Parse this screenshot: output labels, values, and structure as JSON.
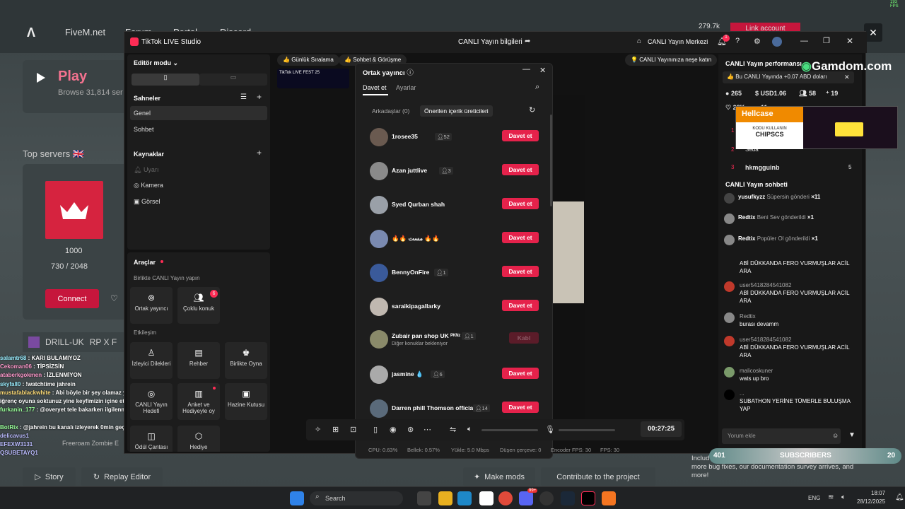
{
  "fivem": {
    "brand": "FiveM.net",
    "nav": [
      "Forum",
      "Portal",
      "Discord"
    ],
    "play": "Play",
    "browse": "Browse 31,814 ser",
    "top_servers": "Top servers",
    "server": {
      "points": "1000",
      "players": "730 / 2048",
      "connect": "Connect",
      "name": "DRILL-UK",
      "tag": "RP X F"
    },
    "votes": "279.7k",
    "link_account": "Link account",
    "story": "Story",
    "replay": "Replay Editor",
    "make_mods": "Make mods",
    "contribute": "Contribute to the project",
    "notice": "more bug fixes, our documentation survey arrives, and more!",
    "notice_prefix": "Includ",
    "freeroam": "Freeroam Zombie E"
  },
  "gta_chat": [
    {
      "n": "salamtr68",
      "m": "KARI BULAMIYOZ"
    },
    {
      "n": "Cekoman06",
      "m": "TİPSİZSİN"
    },
    {
      "n": "ataberkgokmen",
      "m": "İZLENMİYON"
    },
    {
      "n": "skyfall0",
      "m": "!watchtime jahrein"
    },
    {
      "n": "mustafablackwhite",
      "m": "Abi böyle bir şey olamaz ya şu"
    },
    {
      "n": "",
      "m": "iğrenç oyuna soktunuz yine keyfimizin içine ettiniz ya"
    },
    {
      "n": "furkanin_177",
      "m": "@overyet tele bakarken ilgilenmediki"
    },
    {
      "n": "BotRix",
      "m": "@jahrein bu kanalı izleyerek 0min geçirdi."
    },
    {
      "n": "delicavus1",
      "m": ""
    },
    {
      "n": "EFEXW3131",
      "m": ""
    },
    {
      "n": "QSUBETAYQ1",
      "m": ""
    }
  ],
  "tiktok": {
    "app": "TikTok LIVE Studio",
    "center": "CANLI Yayın bilgileri",
    "merkez": "CANLI Yayın Merkezi",
    "notif": "1",
    "editor": "Editör modu",
    "scenes": "Sahneler",
    "scene_items": [
      "Genel",
      "Sohbet"
    ],
    "sources": "Kaynaklar",
    "source_items": [
      "Uyarı",
      "Kamera",
      "Görsel"
    ],
    "tools": "Araçlar",
    "together": "Birlikte CANLI Yayın yapın",
    "co_host": "Ortak yayıncı",
    "multi_guest": "Çoklu konuk",
    "multi_badge": "6",
    "engage": "Etkileşim",
    "tools2": [
      "İzleyici Dilekleri",
      "Rehber",
      "Birlikte Oyna",
      "CANLI Yayın Hedefi",
      "Anket ve Hediyeyle oy",
      "Hazine Kutusu",
      "Ödül Çantası",
      "Hediye"
    ],
    "chip1": "Günlük Sıralama",
    "chip2": "Sohbet & Görüşme",
    "chip3": "CANLI Yayınınıza neşe katın",
    "livefest": "TikTok LIVE FEST 25",
    "modal": {
      "title": "Ortak yayıncı",
      "tab_invite": "Davet et",
      "tab_settings": "Ayarlar",
      "sub_friends": "Arkadaşlar (0)",
      "sub_suggested": "Önerilen içerik üreticileri",
      "rows": [
        {
          "name": "1rosee35",
          "count": "52",
          "btn": "Davet et",
          "sub": "",
          "c": "#6a5a50"
        },
        {
          "name": "Azan juttlive",
          "count": "3",
          "btn": "Davet et",
          "sub": "",
          "c": "#8a8a8a"
        },
        {
          "name": "Syed Qurban shah",
          "count": "",
          "btn": "Davet et",
          "sub": "",
          "c": "#9aa0a8"
        },
        {
          "name": "🔥🔥 مست 🔥🔥",
          "count": "",
          "btn": "Davet et",
          "sub": "",
          "c": "#7a8ab0"
        },
        {
          "name": "BennyOnFire",
          "count": "1",
          "btn": "Davet et",
          "sub": "",
          "c": "#3a5a9a"
        },
        {
          "name": "saraikipagallarky",
          "count": "",
          "btn": "Davet et",
          "sub": "",
          "c": "#c0b8b0"
        },
        {
          "name": "Zubair pan shop UK ᴾᴷᴺᶻ",
          "count": "1",
          "btn": "Kabl",
          "sub": "Diğer konuklar bekleniyor",
          "c": "#8a8a6a"
        },
        {
          "name": "jasmine 💧",
          "count": "6",
          "btn": "Davet et",
          "sub": "",
          "c": "#aaa"
        },
        {
          "name": "Darren phill Thomson official",
          "count": "14",
          "btn": "Davet et",
          "sub": "",
          "c": "#5a6a7a"
        }
      ]
    },
    "timer": "00:27:25",
    "stats": {
      "cpu": "CPU: 0.63%",
      "mem": "Bellek: 0.57%",
      "load": "Yükle: 5.0 Mbps",
      "drop": "Düşen çerçeve: 0",
      "enc": "Encoder FPS: 30",
      "fps": "FPS: 30"
    },
    "perf": {
      "title": "CANLI Yayın performansı",
      "note": "Bu CANLI Yayında +0.07 ABD doları",
      "coins": "265",
      "usd": "USD1.06",
      "viewers": "58",
      "follows": "19",
      "likes": "28K",
      "other": "11"
    },
    "ranking": [
      {
        "r": "1",
        "n": ""
      },
      {
        "r": "2",
        "n": "Seda"
      },
      {
        "r": "3",
        "n": "hkmgguinb",
        "v": "5"
      }
    ],
    "chat_title": "CANLI Yayın sohbeti",
    "gifts": [
      {
        "u": "yusufkyzz",
        "m": "Süpersin gönderi",
        "x": "×11"
      },
      {
        "u": "Redtix",
        "m": "Beni Sev gönderildi",
        "x": "×1"
      },
      {
        "u": "Redtix",
        "m": "Popüler Ol gönderildi",
        "x": "×1"
      }
    ],
    "chat": [
      {
        "u": "",
        "m": "ABİ DÜKKANDA FERO VURMUŞLAR ACİL ARA",
        "c": ""
      },
      {
        "u": "user5418284541082",
        "m": "ABİ DÜKKANDA FERO VURMUŞLAR ACİL ARA",
        "c": "#c0392b"
      },
      {
        "u": "Redtix",
        "m": "burası devamm",
        "c": "#888"
      },
      {
        "u": "user5418284541082",
        "m": "ABİ DÜKKANDA FERO VURMUŞLAR ACİL ARA",
        "c": "#c0392b"
      },
      {
        "u": "malicoskuner",
        "m": "wats up bro",
        "c": "#7a9a6a"
      },
      {
        "u": "...",
        "m": "SUBATHON YERİNE TÜMERLE BULUŞMA YAP",
        "c": "#111"
      }
    ],
    "comment_placeholder": "Yorum ekle"
  },
  "ads": {
    "gamdom": "Gamdom.com",
    "hellcase": "Hellcase",
    "code1": "KODU KULLANIN",
    "code2": "CHIPSCS",
    "subs_left": "401",
    "subs": "SUBSCRIBERS",
    "subs_right": "20"
  },
  "taskbar": {
    "search": "Search",
    "lang": "ENG",
    "time": "18:07",
    "date": "28/12/2025",
    "badge": "99+"
  },
  "fps": "193 FPS"
}
